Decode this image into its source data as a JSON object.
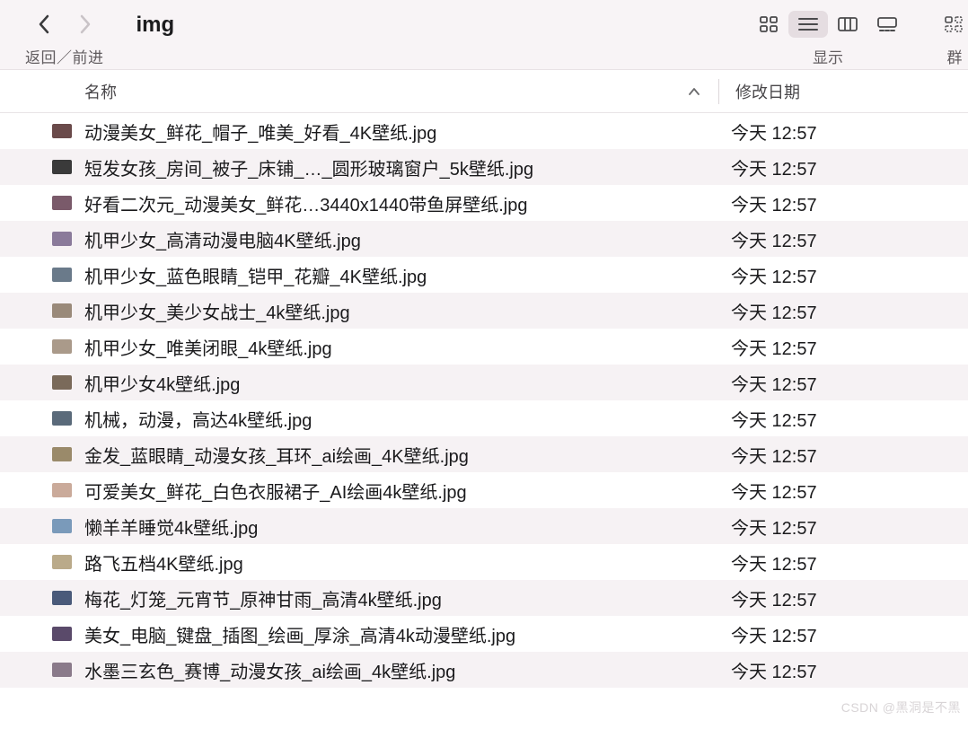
{
  "toolbar": {
    "title": "img",
    "nav_label": "返回／前进",
    "view_label": "显示",
    "group_label": "群"
  },
  "columns": {
    "name": "名称",
    "date": "修改日期"
  },
  "files": [
    {
      "name": "动漫美女_鲜花_帽子_唯美_好看_4K壁纸.jpg",
      "date": "今天 12:57",
      "thumb": "#6a4a4a"
    },
    {
      "name": "短发女孩_房间_被子_床铺_…_圆形玻璃窗户_5k壁纸.jpg",
      "date": "今天 12:57",
      "thumb": "#3a3a3a"
    },
    {
      "name": "好看二次元_动漫美女_鲜花…3440x1440带鱼屏壁纸.jpg",
      "date": "今天 12:57",
      "thumb": "#7a5a6a"
    },
    {
      "name": "机甲少女_高清动漫电脑4K壁纸.jpg",
      "date": "今天 12:57",
      "thumb": "#8a7a9a"
    },
    {
      "name": "机甲少女_蓝色眼睛_铠甲_花瓣_4K壁纸.jpg",
      "date": "今天 12:57",
      "thumb": "#6a7a8a"
    },
    {
      "name": "机甲少女_美少女战士_4k壁纸.jpg",
      "date": "今天 12:57",
      "thumb": "#9a8a7a"
    },
    {
      "name": "机甲少女_唯美闭眼_4k壁纸.jpg",
      "date": "今天 12:57",
      "thumb": "#aa9a8a"
    },
    {
      "name": "机甲少女4k壁纸.jpg",
      "date": "今天 12:57",
      "thumb": "#7a6a5a"
    },
    {
      "name": "机械，动漫，高达4k壁纸.jpg",
      "date": "今天 12:57",
      "thumb": "#5a6a7a"
    },
    {
      "name": "金发_蓝眼睛_动漫女孩_耳环_ai绘画_4K壁纸.jpg",
      "date": "今天 12:57",
      "thumb": "#9a8a6a"
    },
    {
      "name": "可爱美女_鲜花_白色衣服裙子_AI绘画4k壁纸.jpg",
      "date": "今天 12:57",
      "thumb": "#caaa9a"
    },
    {
      "name": "懒羊羊睡觉4k壁纸.jpg",
      "date": "今天 12:57",
      "thumb": "#7a9aba"
    },
    {
      "name": "路飞五档4K壁纸.jpg",
      "date": "今天 12:57",
      "thumb": "#baaa8a"
    },
    {
      "name": "梅花_灯笼_元宵节_原神甘雨_高清4k壁纸.jpg",
      "date": "今天 12:57",
      "thumb": "#4a5a7a"
    },
    {
      "name": "美女_电脑_键盘_插图_绘画_厚涂_高清4k动漫壁纸.jpg",
      "date": "今天 12:57",
      "thumb": "#5a4a6a"
    },
    {
      "name": "水墨三玄色_赛博_动漫女孩_ai绘画_4k壁纸.jpg",
      "date": "今天 12:57",
      "thumb": "#8a7a8a"
    }
  ],
  "watermark": "CSDN @黑洞是不黑"
}
